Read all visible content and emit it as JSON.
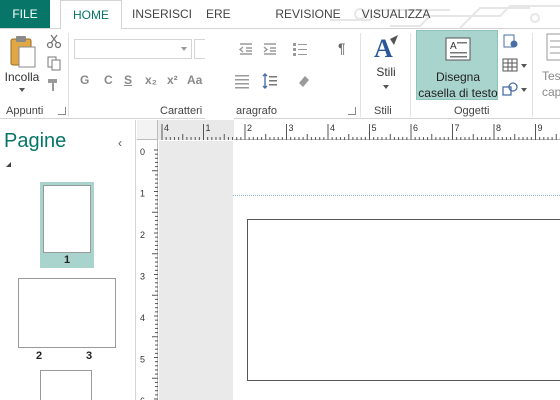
{
  "tabs": {
    "file": "FILE",
    "home": "HOME",
    "insert": "INSERISCI",
    "design": "ERE",
    "review": "REVISIONE",
    "view": "VISUALIZZA"
  },
  "ribbon": {
    "paste_label": "Incolla",
    "clipboard_group": "Appunti",
    "font_group": "Caratteri",
    "paragraph_group": "aragrafo",
    "styles_group": "Stili",
    "objects_group": "Oggetti",
    "styles_label": "Stili",
    "draw_textbox_line1": "Disegna",
    "draw_textbox_line2": "casella di testo",
    "cut_off_line1": "Tes",
    "cut_off_line2": "cap",
    "format": {
      "bold": "G",
      "italic": "C",
      "underline": "S",
      "subscript": "x₂",
      "superscript": "x²",
      "font_size": "Aa"
    }
  },
  "pages_panel": {
    "title": "Pagine",
    "page1": "1",
    "page2": "2",
    "page3": "3"
  },
  "rulers": {
    "horizontal": [
      "4",
      "1",
      "2",
      "3",
      "4",
      "5",
      "6",
      "7",
      "8",
      "9"
    ],
    "vertical": [
      "0",
      "1",
      "2",
      "3",
      "4",
      "5",
      "6"
    ]
  },
  "colors": {
    "accent": "#077568",
    "selected": "#a9d4ce"
  }
}
